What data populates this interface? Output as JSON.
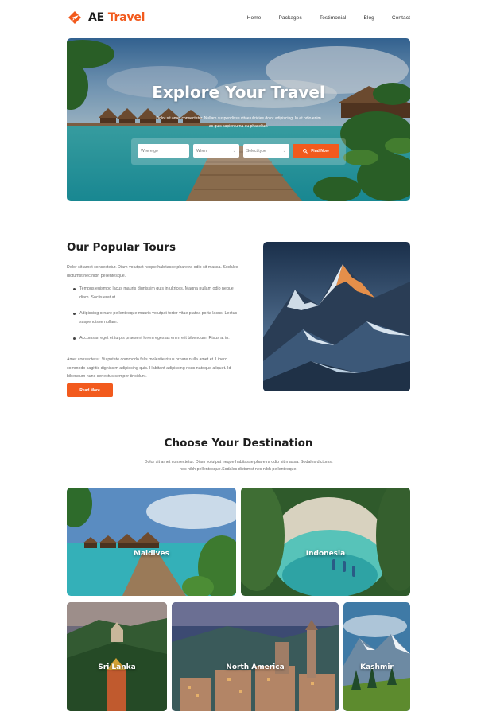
{
  "nav": {
    "brand_prefix": "AE",
    "brand_accent": "Travel",
    "links": [
      "Home",
      "Packages",
      "Testimonial",
      "Blog",
      "Contact"
    ]
  },
  "hero": {
    "title": "Explore Your Travel",
    "subtitle": "Dolor sit amet consectetur. Nullam suspendisse vitae ultricies dolor adipiscing. In et odio enim ac quis sapien urna eu phasellus.",
    "search": {
      "where_placeholder": "Where go",
      "when_placeholder": "When",
      "type_placeholder": "Select type",
      "button": "Find Now"
    }
  },
  "tours": {
    "title": "Our Popular Tours",
    "intro": "Dolor sit amet consectetur. Diam volutpat neque habitasse pharetra odio sit massa. Sodales dictumst nec nibh pellentesque.",
    "bullets": [
      "Tempus euismod lacus mauris dignissim quis in ultrices. Magna nullam odio neque diam. Sociis erat at .",
      "Adipiscing ornare pellentesque mauris volutpat tortor vitae platea porta lacus. Lectus suspendisse nullam.",
      "Accumsan eget et turpis praesent lorem egestas enim elit bibendum. Risus at in."
    ],
    "outro": "Amet consectetur. Vulputate commodo felis molestie risus ornare nulla amet et. Libero commodo sagittis dignissim adipiscing quis. Habitant adipiscing risus natoque aliquet. Id bibendum nunc senectus semper tincidunt.",
    "button": "Read More"
  },
  "destinations": {
    "title": "Choose Your Destination",
    "subtitle": "Dolor sit amet consectetur. Diam volutpat neque habitasse pharetra odio sit massa. Sodales dictumst nec nibh pellentesque.Sodales dictumst nec nibh pellentesque.",
    "cards": [
      "Maldives",
      "Indonesia",
      "Sri Lanka",
      "North America",
      "Kashmir"
    ]
  },
  "colors": {
    "accent": "#f25a1d",
    "heading": "#1e1e1e",
    "body_text": "#6a6a6a"
  }
}
